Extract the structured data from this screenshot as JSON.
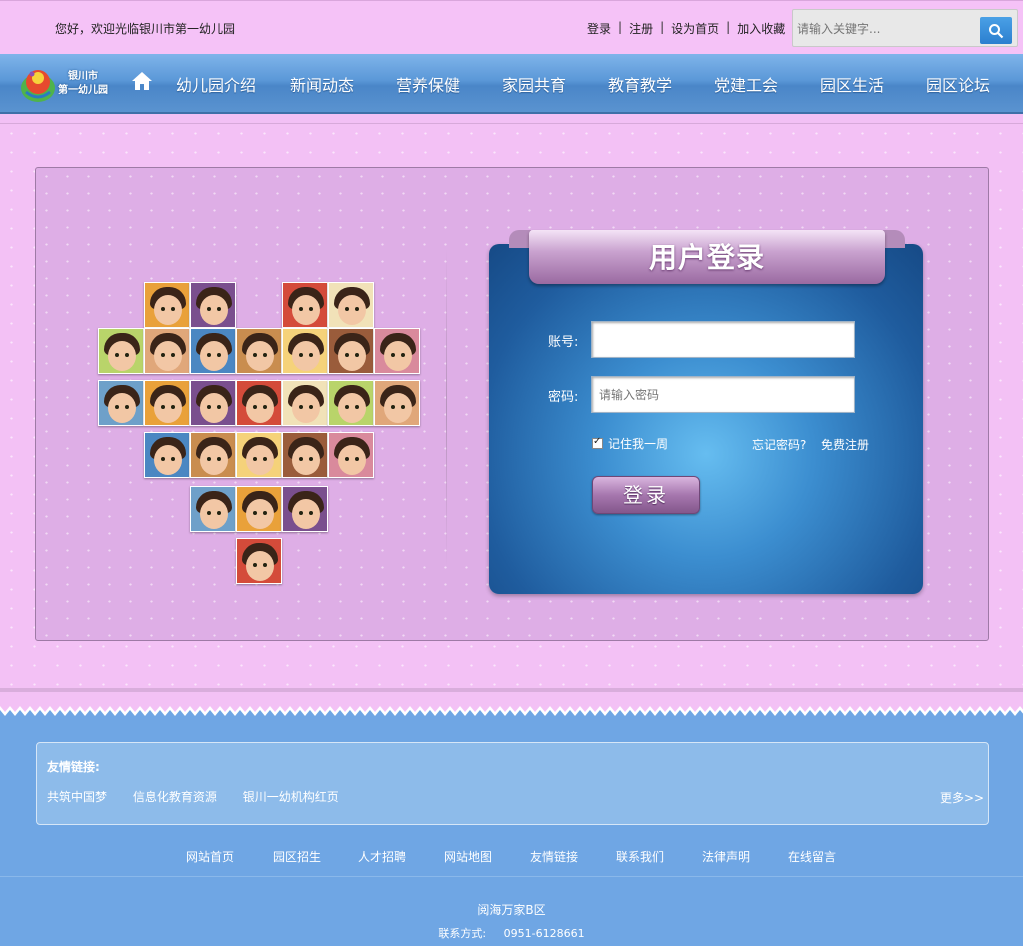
{
  "topbar": {
    "welcome": "您好，欢迎光临银川市第一幼儿园",
    "links": [
      "登录",
      "注册",
      "设为首页",
      "加入收藏"
    ],
    "search_placeholder": "请输入关键字..."
  },
  "logo": {
    "line1": "银川市",
    "line2": "第一幼儿园"
  },
  "nav": {
    "items": [
      "幼儿园介绍",
      "新闻动态",
      "营养保健",
      "家园共育",
      "教育教学",
      "党建工会",
      "园区生活",
      "园区论坛"
    ]
  },
  "login": {
    "title": "用户登录",
    "account_label": "账号:",
    "password_label": "密码:",
    "account_value": "",
    "password_placeholder": "请输入密码",
    "remember": "记住我一周",
    "forgot": "忘记密码?",
    "register": "免费注册",
    "submit": "登录"
  },
  "footer": {
    "friend_title": "友情链接:",
    "friend_links": [
      "共筑中国梦",
      "信息化教育资源",
      "银川一幼机构红页"
    ],
    "more": "更多>>",
    "nav": [
      "网站首页",
      "园区招生",
      "人才招聘",
      "网站地图",
      "友情链接",
      "联系我们",
      "法律声明",
      "在线留言"
    ],
    "address": "阅海万家B区",
    "contact_label": "联系方式:",
    "contact_value": "0951-6128661"
  },
  "colors": {
    "pink": "#f4c3f6",
    "nav_blue": "#5b98d8",
    "footer_blue": "#6fa6e4",
    "login_blue": "#3c8ed0"
  }
}
